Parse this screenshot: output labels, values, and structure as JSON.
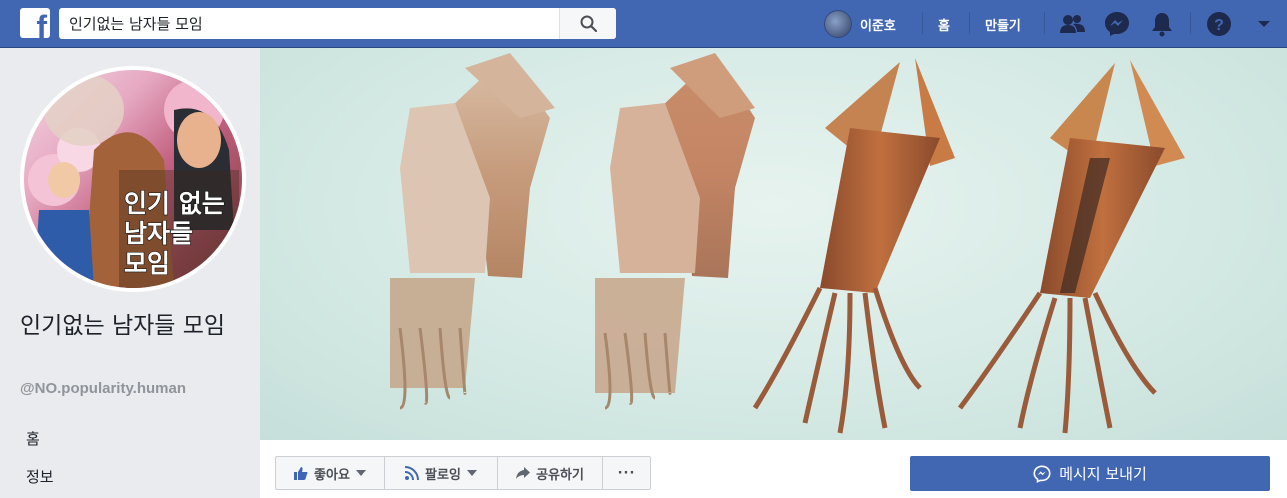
{
  "topbar": {
    "search_value": "인기없는 남자들 모임",
    "user_name": "이준호",
    "home_label": "홈",
    "create_label": "만들기"
  },
  "page": {
    "title": "인기없는 남자들 모임",
    "handle": "@NO.popularity.human",
    "profile_text": [
      "인기 없는",
      "남자들",
      "모임"
    ],
    "nav": [
      "홈",
      "정보"
    ]
  },
  "actions": {
    "like_label": "좋아요",
    "follow_label": "팔로잉",
    "share_label": "공유하기",
    "more_label": "···",
    "message_label": "메시지 보내기"
  },
  "colors": {
    "brand": "#4267b2",
    "background": "#e9ebee"
  }
}
